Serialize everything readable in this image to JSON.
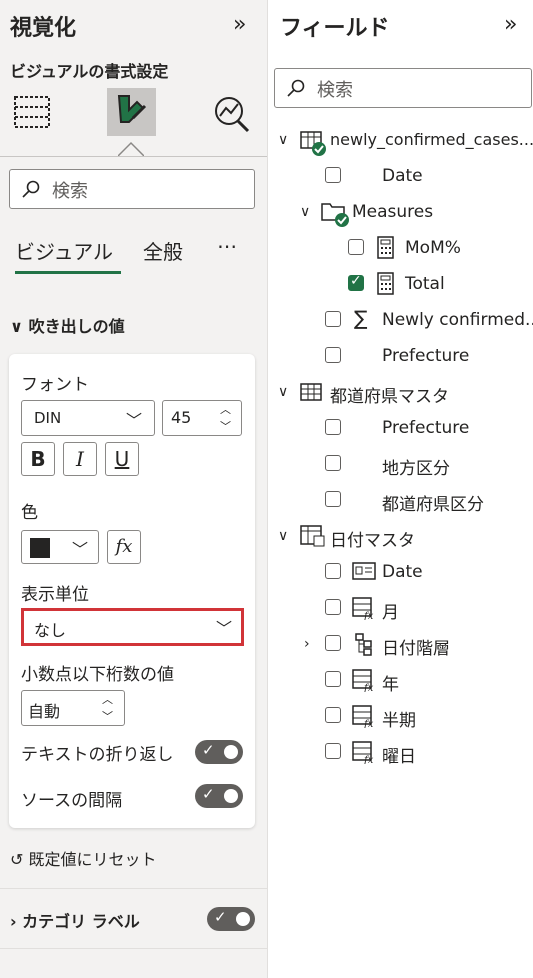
{
  "left": {
    "title": "視覚化",
    "subtitle": "ビジュアルの書式設定",
    "search_placeholder": "検索",
    "tabs": [
      "ビジュアル",
      "全般",
      "⋯"
    ],
    "section_title": "吹き出しの値",
    "font_label": "フォント",
    "font_family": "DIN",
    "font_size": "45",
    "bold": "B",
    "italic": "I",
    "underline": "U",
    "color_label": "色",
    "color_value": "#252423",
    "fx": "fx",
    "display_units_label": "表示単位",
    "display_units_value": "なし",
    "decimal_label": "小数点以下桁数の値",
    "decimal_value": "自動",
    "text_wrap_label": "テキストの折り返し",
    "source_spacing_label": "ソースの間隔",
    "reset_label": "既定値にリセット",
    "category_label": "カテゴリ ラベル"
  },
  "right": {
    "title": "フィールド",
    "search_placeholder": "検索",
    "tree": [
      {
        "label": "newly_confirmed_cases...",
        "kind": "table-check",
        "level": 0,
        "expanded": true
      },
      {
        "label": "Date",
        "kind": "none",
        "level": 1,
        "checked": false
      },
      {
        "label": "Measures",
        "kind": "folder",
        "level": 1,
        "expanded": true
      },
      {
        "label": "MoM%",
        "kind": "calc",
        "level": 2,
        "checked": false
      },
      {
        "label": "Total",
        "kind": "calc",
        "level": 2,
        "checked": true
      },
      {
        "label": "Newly confirmed...",
        "kind": "sigma",
        "level": 1,
        "checked": false
      },
      {
        "label": "Prefecture",
        "kind": "none",
        "level": 1,
        "checked": false
      },
      {
        "label": "都道府県マスタ",
        "kind": "table",
        "level": 0,
        "expanded": true
      },
      {
        "label": "Prefecture",
        "kind": "none",
        "level": 1,
        "checked": false
      },
      {
        "label": "地方区分",
        "kind": "none",
        "level": 1,
        "checked": false
      },
      {
        "label": "都道府県区分",
        "kind": "none",
        "level": 1,
        "checked": false
      },
      {
        "label": "日付マスタ",
        "kind": "table-date",
        "level": 0,
        "expanded": true
      },
      {
        "label": "Date",
        "kind": "id",
        "level": 1,
        "checked": false
      },
      {
        "label": "月",
        "kind": "fx",
        "level": 1,
        "checked": false
      },
      {
        "label": "日付階層",
        "kind": "hier",
        "level": 1,
        "checked": false,
        "collapsed": true
      },
      {
        "label": "年",
        "kind": "fx",
        "level": 1,
        "checked": false
      },
      {
        "label": "半期",
        "kind": "fx",
        "level": 1,
        "checked": false
      },
      {
        "label": "曜日",
        "kind": "fx",
        "level": 1,
        "checked": false
      }
    ]
  },
  "colors": {
    "accent": "#217346",
    "highlight": "#d13438",
    "toggle": "#605e5c"
  }
}
